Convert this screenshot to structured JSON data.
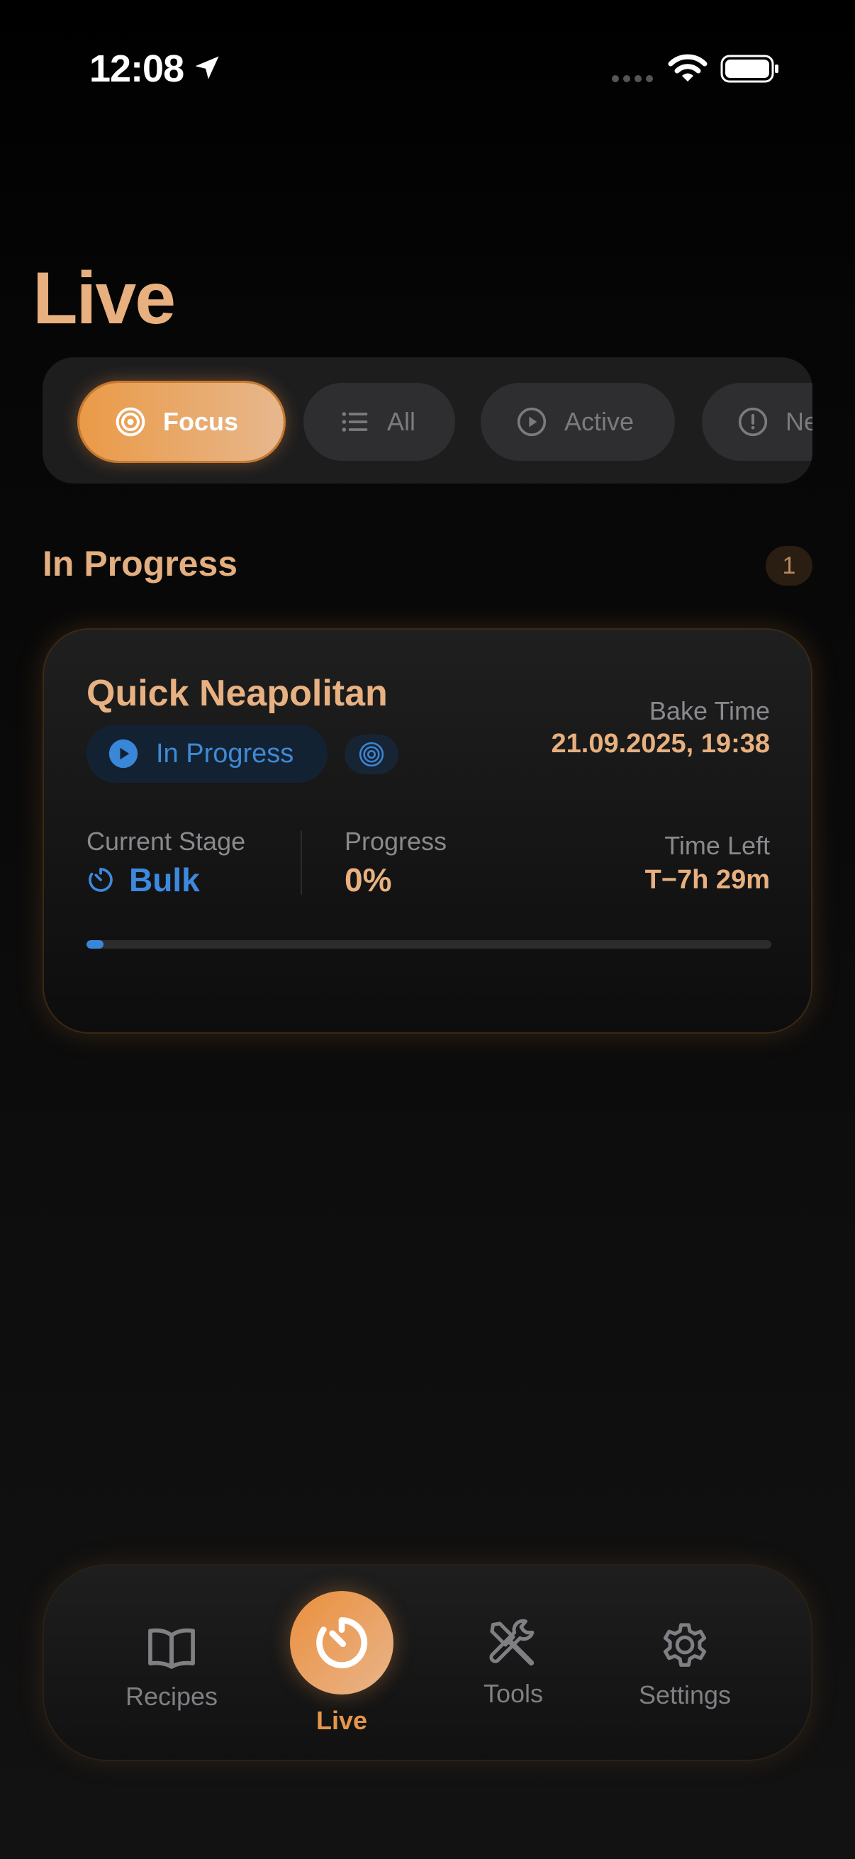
{
  "status_bar": {
    "time": "12:08",
    "icons": [
      "location-arrow-icon",
      "cellular-signal-icon",
      "wifi-icon",
      "battery-icon"
    ]
  },
  "page": {
    "title": "Live"
  },
  "filters": {
    "selected": "Focus",
    "items": [
      {
        "label": "Focus",
        "icon": "target-icon"
      },
      {
        "label": "All",
        "icon": "list-icon"
      },
      {
        "label": "Active",
        "icon": "play-circle-icon"
      },
      {
        "label": "Ne",
        "icon": "exclamation-circle-icon"
      }
    ]
  },
  "section": {
    "title": "In Progress",
    "count": "1"
  },
  "bake_card": {
    "name": "Quick Neapolitan",
    "status": "In Progress",
    "bake_time_label": "Bake Time",
    "bake_time_value": "21.09.2025, 19:38",
    "current_stage_label": "Current Stage",
    "current_stage_value": "Bulk",
    "progress_label": "Progress",
    "progress_value": "0%",
    "progress_fraction": 0.0,
    "time_left_label": "Time Left",
    "time_left_value": "T−7h 29m"
  },
  "tab_bar": {
    "active": "Live",
    "tabs": [
      {
        "label": "Recipes",
        "icon": "book-icon"
      },
      {
        "label": "Live",
        "icon": "timer-icon"
      },
      {
        "label": "Tools",
        "icon": "tools-icon"
      },
      {
        "label": "Settings",
        "icon": "gear-icon"
      }
    ]
  },
  "colors": {
    "accent_orange": "#e8b07e",
    "accent_blue": "#3c8ae0",
    "background": "#0c0c0c"
  }
}
